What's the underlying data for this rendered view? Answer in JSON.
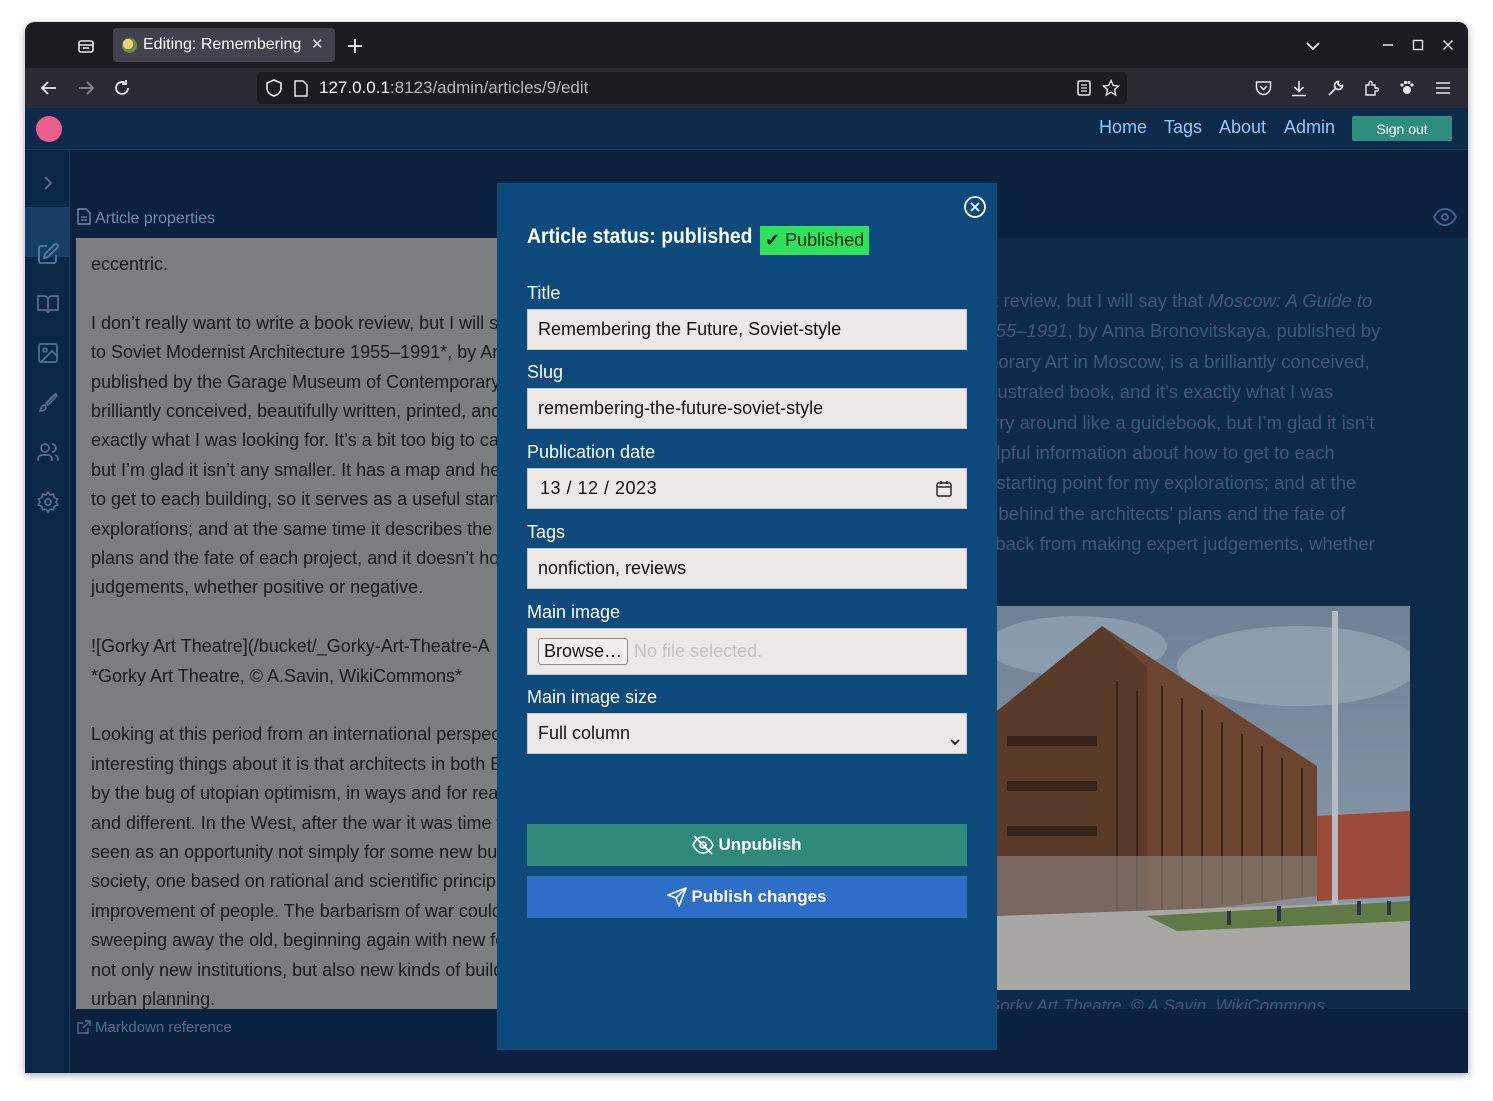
{
  "browser": {
    "tab_title": "Editing: Remembering",
    "url_host": "127.0.0.1",
    "url_path": ":8123/admin/articles/9/edit"
  },
  "header": {
    "nav": [
      "Home",
      "Tags",
      "About",
      "Admin"
    ],
    "signout_label": "Sign out"
  },
  "editor": {
    "properties_label": "Article properties",
    "markdown_ref_label": "Markdown reference",
    "paragraphs": [
      [
        "eccentric."
      ],
      [
        "I don’t really want to write a book review, but I will say that *Moscow: A Guide",
        "to Soviet Modernist Architecture 1955–1991*, by Anna Bronovitskaya,",
        "published by the Garage Museum of Contemporary Art in Moscow, is a",
        "brilliantly conceived, beautifully written, printed, and illustrated book, and it’s",
        "exactly what I was looking for. It’s a bit too big to carry around like a guidebook,",
        "but I’m glad it isn’t any smaller. It has a map and helpful information about how",
        "to get to each building, so it serves as a useful starting point for my",
        "explorations; and at the same time it describes the ideas behind the architects’",
        "plans and the fate of each project, and it doesn’t hold back from making expert",
        "judgements, whether positive or negative."
      ],
      [
        "![Gorky Art Theatre](/bucket/_Gorky-Art-Theatre-A",
        "*Gorky Art Theatre, © A.Savin, WikiCommons*"
      ],
      [
        "Looking at this period from an international perspective, one of the most",
        "interesting things about it is that architects in both East and West were bitten",
        "by the bug of utopian optimism, in ways and for reasons that were both similar",
        "and different. In the West, after the war it was time to rebuild, and this was",
        "seen as an opportunity not simply for some new buildings but for a new",
        "society, one based on rational and scientific principles devoted to the",
        "improvement of people. The barbarism of war could be overcome only by",
        "sweeping away the old, beginning again with new forms — creating",
        "not only new institutions, but also new kinds of buildings, new approaches to",
        "urban planning."
      ]
    ]
  },
  "preview": {
    "lines": [
      "I don’t really want to write a book review, but I will say that <i>Moscow: A Guide to</i>",
      "<i>Soviet Modernist Architecture 1955–1991</i>, by Anna Bronovitskaya, published by",
      "the Garage Museum of Contemporary Art in Moscow, is a brilliantly conceived,",
      "beautifully written, printed, and illustrated book, and it’s exactly what I was",
      "looking for. It’s a bit too big to carry around like a guidebook, but I’m glad it isn’t",
      "any smaller. It has a map and helpful information about how to get to each",
      "building, so it serves as a useful starting point for my explorations; and at the",
      "same time it describes the ideas behind the architects’ plans and the fate of",
      "each project, and it doesn’t hold back from making expert judgements, whether"
    ],
    "caption": "Gorky Art Theatre, © A.Savin, WikiCommons"
  },
  "modal": {
    "status_title": "Article status: published",
    "status_badge": "✔ Published",
    "title_label": "Title",
    "title_value": "Remembering the Future, Soviet-style",
    "slug_label": "Slug",
    "slug_value": "remembering-the-future-soviet-style",
    "date_label": "Publication date",
    "date_value": "13 / 12 / 2023",
    "tags_label": "Tags",
    "tags_value": "nonfiction, reviews",
    "image_label": "Main image",
    "browse_label": "Browse…",
    "no_file_label": "No file selected.",
    "image_size_label": "Main image size",
    "image_size_value": "Full column",
    "unpublish_label": "Unpublish",
    "publish_label": "Publish changes"
  },
  "colors": {
    "app_bg": "#0a2240",
    "modal_bg": "#0c4a7c",
    "badge": "#2ee05a",
    "unpublish": "#2f8a7c",
    "publish": "#2e6ec6",
    "logo": "#ec5f8c"
  }
}
